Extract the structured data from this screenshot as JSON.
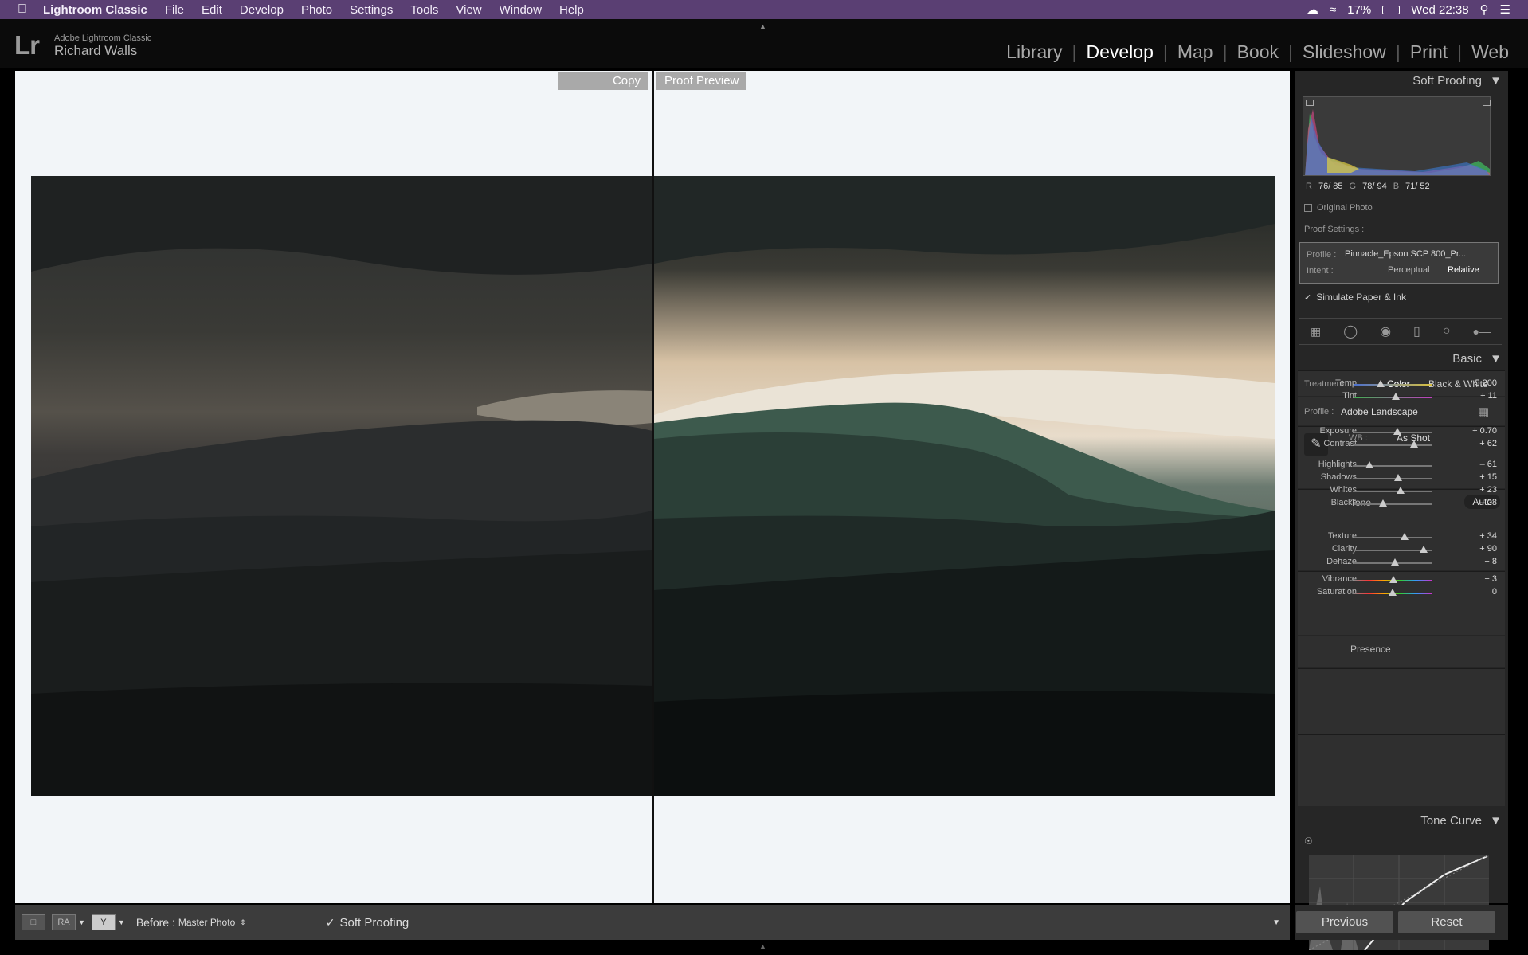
{
  "menubar": {
    "items": [
      "Lightroom Classic",
      "File",
      "Edit",
      "Develop",
      "Photo",
      "Settings",
      "Tools",
      "View",
      "Window",
      "Help"
    ],
    "battery": "17%",
    "clock": "Wed 22:38"
  },
  "identity": {
    "logo": "Lr",
    "app": "Adobe Lightroom Classic",
    "user": "Richard Walls"
  },
  "modules": {
    "items": [
      "Library",
      "Develop",
      "Map",
      "Book",
      "Slideshow",
      "Print",
      "Web"
    ],
    "active": "Develop"
  },
  "viewer": {
    "left_label": "Copy",
    "right_label": "Proof Preview"
  },
  "toolbar": {
    "before_label": "Before :",
    "before_value": "Master Photo",
    "soft_proofing_label": "Soft Proofing",
    "soft_proofing_checked": true
  },
  "panel": {
    "soft_proofing_title": "Soft Proofing",
    "histogram": {
      "r_label": "R",
      "r_value": "76/ 85",
      "g_label": "G",
      "g_value": "78/ 94",
      "b_label": "B",
      "b_value": "71/ 52"
    },
    "original_photo_label": "Original Photo",
    "proof_settings_label": "Proof Settings :",
    "profile_label": "Profile :",
    "profile_value": "Pinnacle_Epson SCP 800_Pr...",
    "intent_label": "Intent :",
    "intent_options": [
      "Perceptual",
      "Relative"
    ],
    "intent_selected": "Relative",
    "simulate_label": "Simulate Paper & Ink",
    "basic_title": "Basic",
    "treatment_label": "Treatment :",
    "treatment_options": [
      "Color",
      "Black & White"
    ],
    "treatment_selected": "Color",
    "basic_profile_label": "Profile :",
    "basic_profile_value": "Adobe Landscape",
    "wb_label": "WB :",
    "wb_value": "As Shot",
    "tone_label": "Tone",
    "auto_label": "Auto",
    "presence_label": "Presence",
    "tone_curve_title": "Tone Curve"
  },
  "sliders": [
    {
      "name": "Temp",
      "value": "5,200",
      "pos": 0.35
    },
    {
      "name": "Tint",
      "value": "+ 11",
      "pos": 0.54
    },
    {
      "name": "Exposure",
      "value": "+ 0.70",
      "pos": 0.56
    },
    {
      "name": "Contrast",
      "value": "+ 62",
      "pos": 0.78
    },
    {
      "name": "Highlights",
      "value": "– 61",
      "pos": 0.2
    },
    {
      "name": "Shadows",
      "value": "+ 15",
      "pos": 0.57
    },
    {
      "name": "Whites",
      "value": "+ 23",
      "pos": 0.6
    },
    {
      "name": "Blacks",
      "value": "– 28",
      "pos": 0.38
    },
    {
      "name": "Texture",
      "value": "+ 34",
      "pos": 0.65
    },
    {
      "name": "Clarity",
      "value": "+ 90",
      "pos": 0.9
    },
    {
      "name": "Dehaze",
      "value": "+ 8",
      "pos": 0.53
    },
    {
      "name": "Vibrance",
      "value": "+ 3",
      "pos": 0.51
    },
    {
      "name": "Saturation",
      "value": "0",
      "pos": 0.5
    }
  ],
  "buttons": {
    "previous": "Previous",
    "reset": "Reset"
  }
}
